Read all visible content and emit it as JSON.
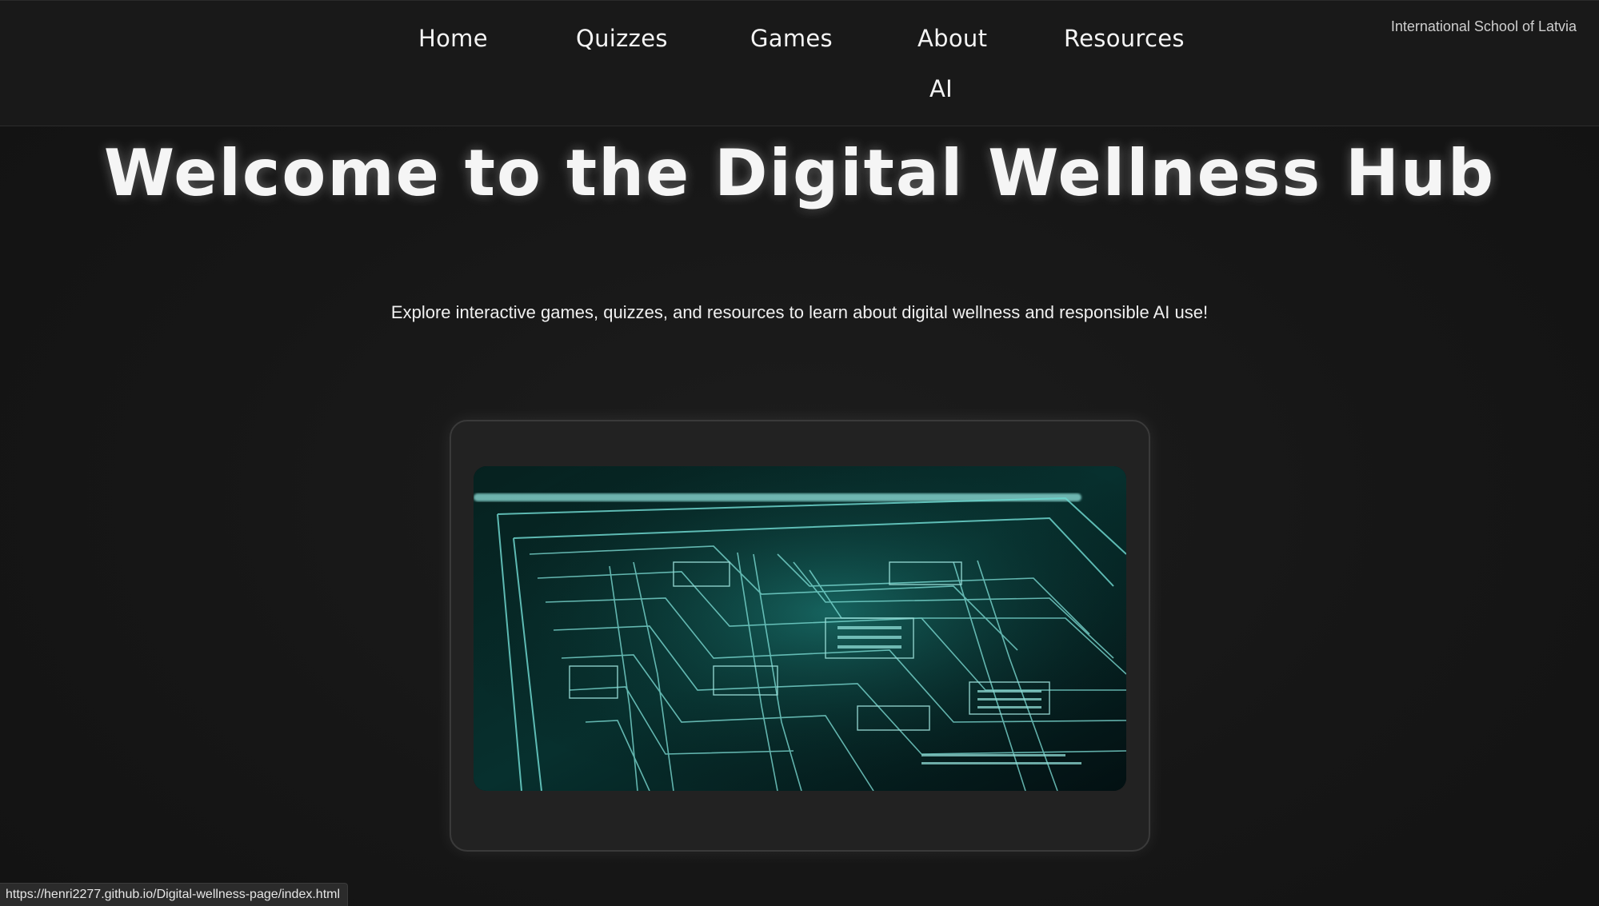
{
  "nav": {
    "items": [
      {
        "label": "Home"
      },
      {
        "label": "Quizzes"
      },
      {
        "label": "Games"
      },
      {
        "label": "About"
      },
      {
        "label": "Resources"
      },
      {
        "label": "AI"
      }
    ]
  },
  "header": {
    "school": "International School of Latvia"
  },
  "main": {
    "title": "Welcome to the Digital Wellness Hub",
    "subtitle": "Explore interactive games, quizzes, and resources to learn about digital wellness and responsible AI use!"
  },
  "status_bar": {
    "url": "https://henri2277.github.io/Digital-wellness-page/index.html"
  },
  "colors": {
    "background": "#141414",
    "topbar": "#191919",
    "card": "#222222",
    "circuit_glow": "#5ff0e6"
  },
  "icons": {
    "hero": "circuit-board-image"
  }
}
